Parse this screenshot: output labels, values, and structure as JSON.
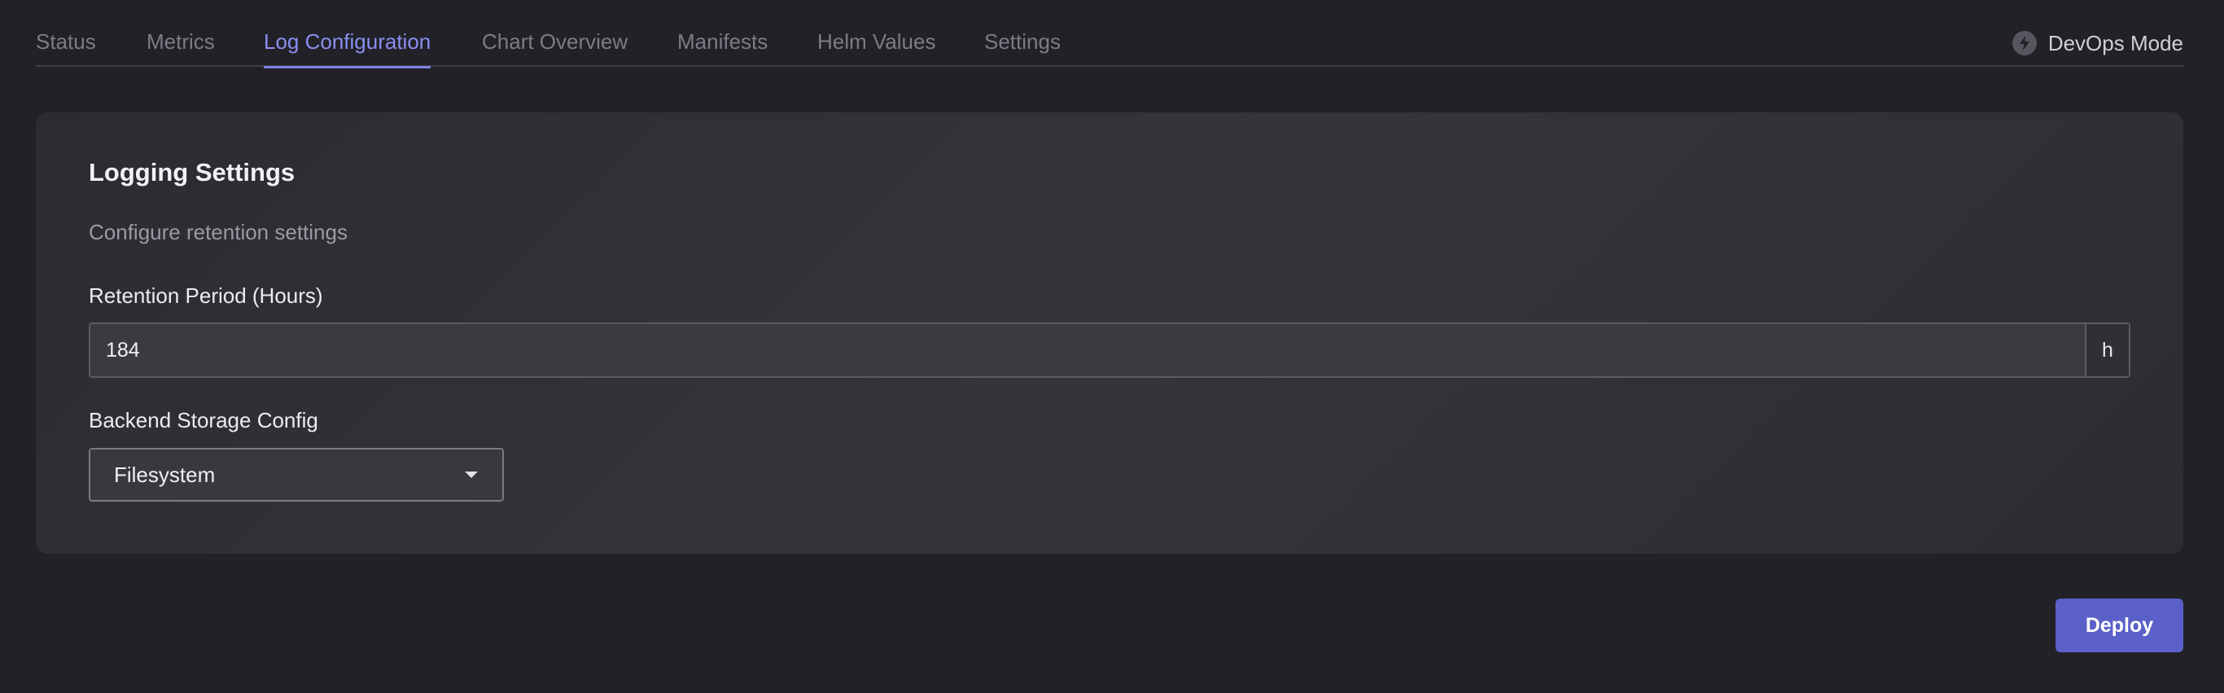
{
  "tabs": [
    {
      "label": "Status",
      "active": false
    },
    {
      "label": "Metrics",
      "active": false
    },
    {
      "label": "Log Configuration",
      "active": true
    },
    {
      "label": "Chart Overview",
      "active": false
    },
    {
      "label": "Manifests",
      "active": false
    },
    {
      "label": "Helm Values",
      "active": false
    },
    {
      "label": "Settings",
      "active": false
    }
  ],
  "devops_mode": {
    "label": "DevOps Mode",
    "icon": "lightning-bolt-icon"
  },
  "card": {
    "title": "Logging Settings",
    "subtitle": "Configure retention settings",
    "retention": {
      "label": "Retention Period (Hours)",
      "value": "184",
      "suffix": "h"
    },
    "storage": {
      "label": "Backend Storage Config",
      "selected": "Filesystem"
    }
  },
  "actions": {
    "deploy_label": "Deploy"
  },
  "colors": {
    "accent": "#8b8ff0",
    "button": "#5a60c8",
    "background": "#212127"
  }
}
